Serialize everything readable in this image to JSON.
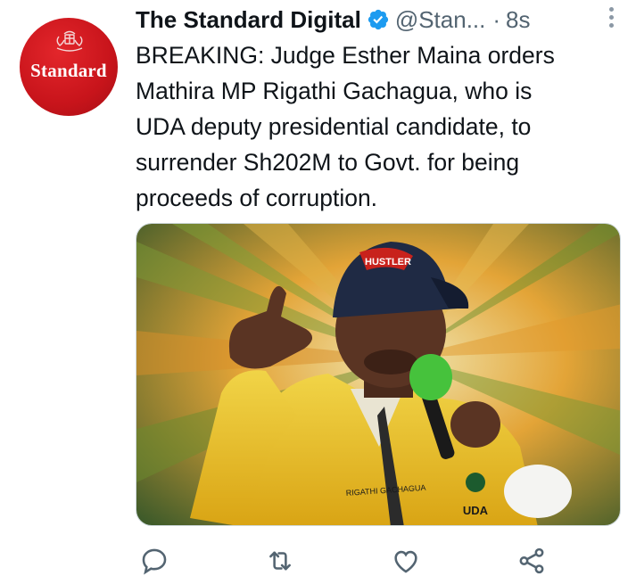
{
  "author": {
    "display_name": "The Standard Digital",
    "handle": "@Stan...",
    "verified": true,
    "avatar_text": "Standard",
    "brand_color": "#c8141b"
  },
  "tweet": {
    "separator": "·",
    "timestamp": "8s",
    "text": "BREAKING: Judge Esther Maina orders\nMathira MP Rigathi Gachagua, who is\nUDA deputy presidential candidate, to\nsurrender Sh202M to Govt. for being\nproceeds of corruption."
  },
  "media": {
    "cap_text": "HUSTLER",
    "jacket_name": "RIGATHI GACHAGUA",
    "badge_text": "UDA"
  },
  "actions": {
    "reply_icon": "reply-icon",
    "retweet_icon": "retweet-icon",
    "like_icon": "like-icon",
    "share_icon": "share-icon"
  }
}
